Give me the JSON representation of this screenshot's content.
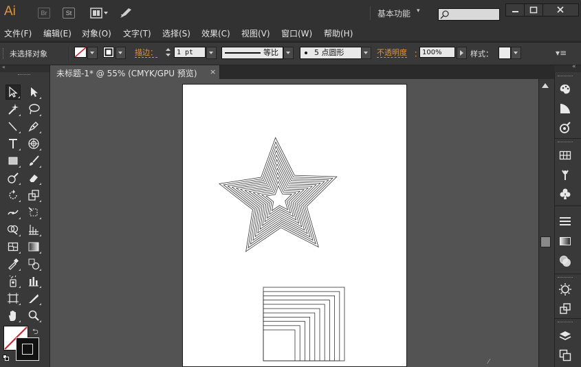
{
  "app": {
    "logo": "Ai",
    "badges": [
      "Br",
      "St"
    ],
    "workspace": "基本功能",
    "workspace_caret": "▾"
  },
  "menu": {
    "items": [
      "文件(F)",
      "编辑(E)",
      "对象(O)",
      "文字(T)",
      "选择(S)",
      "效果(C)",
      "视图(V)",
      "窗口(W)",
      "帮助(H)"
    ]
  },
  "control": {
    "selection_label": "未选择对象",
    "stroke_label": "描边",
    "stroke_colon": "：",
    "stroke_weight": "1 pt",
    "stroke_profile": "等比",
    "brush": "5 点圆形",
    "opacity_label": "不透明度",
    "opacity_value": "100%",
    "style_label": "样式："
  },
  "document": {
    "tab_title": "未标题-1* @ 55% (CMYK/GPU 预览)",
    "close_glyph": "×"
  },
  "panel_glyphs": {
    "collapse_left": "«",
    "collapse_right": "«",
    "panel_menu": "▾≡"
  },
  "colors": {
    "accent": "#e0953a",
    "ui_dark": "#323232",
    "canvas": "#535353",
    "artboard": "#ffffff"
  }
}
